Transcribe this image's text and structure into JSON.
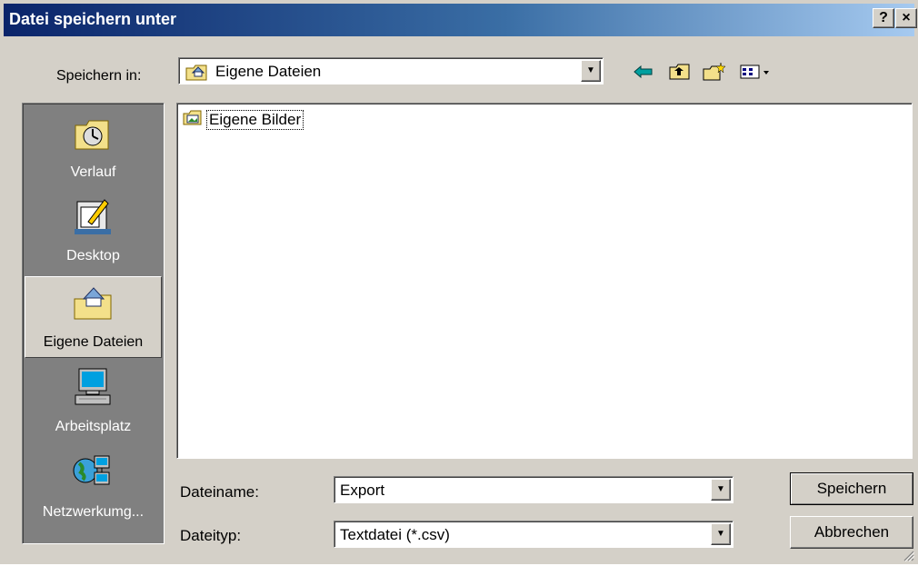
{
  "window": {
    "title": "Datei speichern unter",
    "help_label": "?",
    "close_label": "×"
  },
  "save_in": {
    "label": "Speichern in:",
    "value": "Eigene Dateien",
    "icon": "my-documents-folder-icon"
  },
  "toolbar": [
    "back-arrow-icon",
    "up-folder-icon",
    "new-folder-icon",
    "view-menu-icon"
  ],
  "places": [
    {
      "label": "Verlauf",
      "icon": "history-clock-folder-icon",
      "active": false
    },
    {
      "label": "Desktop",
      "icon": "desktop-icon",
      "active": false
    },
    {
      "label": "Eigene Dateien",
      "icon": "my-documents-icon",
      "active": true
    },
    {
      "label": "Arbeitsplatz",
      "icon": "computer-icon",
      "active": false
    },
    {
      "label": "Netzwerkumg...",
      "icon": "network-icon",
      "active": false
    }
  ],
  "files": [
    {
      "name": "Eigene Bilder",
      "icon": "pictures-folder-icon"
    }
  ],
  "filename": {
    "label": "Dateiname:",
    "value": "Export"
  },
  "filetype": {
    "label": "Dateityp:",
    "value": "Textdatei (*.csv)"
  },
  "buttons": {
    "save": "Speichern",
    "cancel": "Abbrechen"
  },
  "colors": {
    "title_start": "#0a246a",
    "title_end": "#a6caf0",
    "face": "#d4d0c8",
    "places_bg": "#808080"
  }
}
